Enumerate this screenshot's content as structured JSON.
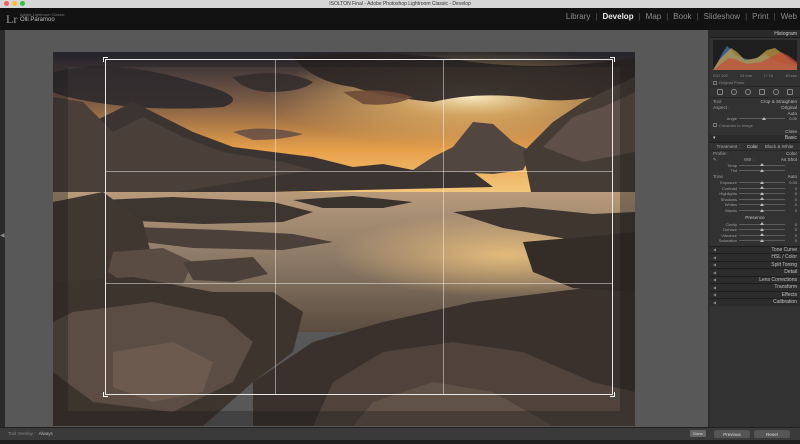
{
  "window": {
    "title": "ISOLTON Final - Adobe Photoshop Lightroom Classic - Develop",
    "lights": [
      "#fc5f57",
      "#fdbc2e",
      "#28c840"
    ]
  },
  "identity": {
    "logo": "Lr",
    "small_text": "Adobe Lightroom Classic",
    "name": "Olli Paramoo"
  },
  "modules": [
    "Library",
    "Develop",
    "Map",
    "Book",
    "Slideshow",
    "Print",
    "Web"
  ],
  "active_module": "Develop",
  "right_panel": {
    "histogram_title": "Histogram",
    "histogram_readout": [
      "ISO 100",
      "24 mm",
      "f / 16",
      "30 sec"
    ],
    "original_photo_label": "Original Photo",
    "tool_label": "Tool",
    "crop_label": "Crop & Straighten",
    "aspect_label": "Aspect :",
    "aspect_value": "Original",
    "auto_label": "Auto",
    "angle_label": "Angle",
    "angle_value": "0.00",
    "constrain_label": "Constrain to Image",
    "close_label": "Close",
    "basic_title": "Basic",
    "treatment_label": "Treatment :",
    "treatment_options": [
      "Color",
      "Black & White"
    ],
    "profile_label": "Profile :",
    "profile_value": "Color",
    "wb_label": "WB :",
    "wb_value": "As Shot",
    "wb_sliders": [
      {
        "label": "Temp",
        "value": "",
        "pos": 0.5
      },
      {
        "label": "Tint",
        "value": "",
        "pos": 0.5
      }
    ],
    "tone_title": "Tone",
    "tone_auto": "Auto",
    "tone_sliders": [
      {
        "label": "Exposure",
        "value": "0.00",
        "pos": 0.5
      },
      {
        "label": "Contrast",
        "value": "0",
        "pos": 0.5
      },
      {
        "label": "Highlights",
        "value": "0",
        "pos": 0.5
      },
      {
        "label": "Shadows",
        "value": "0",
        "pos": 0.5
      },
      {
        "label": "Whites",
        "value": "0",
        "pos": 0.5
      },
      {
        "label": "Blacks",
        "value": "0",
        "pos": 0.5
      }
    ],
    "presence_title": "Presence",
    "presence_sliders": [
      {
        "label": "Clarity",
        "value": "0",
        "pos": 0.5
      },
      {
        "label": "Dehaze",
        "value": "0",
        "pos": 0.5
      },
      {
        "label": "Vibrance",
        "value": "0",
        "pos": 0.5
      },
      {
        "label": "Saturation",
        "value": "0",
        "pos": 0.5
      }
    ],
    "collapsed_panels": [
      "Tone Curve",
      "HSL / Color",
      "Split Toning",
      "Detail",
      "Lens Corrections",
      "Transform",
      "Effects",
      "Calibration"
    ]
  },
  "bottom": {
    "hint_label": "Tool Overlay :",
    "hint_value": "Always",
    "done_label": "Done",
    "previous_label": "Previous",
    "reset_label": "Reset"
  }
}
